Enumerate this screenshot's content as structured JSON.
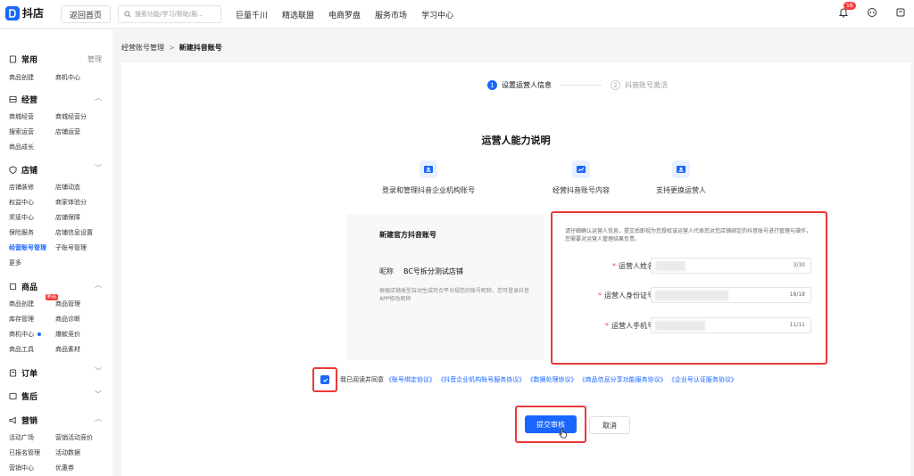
{
  "topbar": {
    "logo_text": "抖店",
    "back_home": "返回首页",
    "search_placeholder": "搜索功能/学习/帮助/服...",
    "nav": [
      "巨量千川",
      "精选联盟",
      "电商罗盘",
      "服务市场",
      "学习中心"
    ],
    "notif_count": "16"
  },
  "sidebar": {
    "common": {
      "title": "常用",
      "manage": "管理",
      "items": [
        "商品创建",
        "商机中心"
      ]
    },
    "operations": {
      "title": "经营",
      "items": [
        "商城经营",
        "商城经营分",
        "搜索运营",
        "店铺运营",
        "商品成长"
      ]
    },
    "store": {
      "title": "店铺",
      "items": [
        "店铺装修",
        "店铺动态",
        "权益中心",
        "商家体验分",
        "奖惩中心",
        "店铺保障",
        "保险服务",
        "店铺信息设置",
        "经营账号管理",
        "子账号管理",
        "更多"
      ]
    },
    "goods": {
      "title": "商品",
      "new_tag": "新品",
      "items": [
        "商品创建",
        "商品管理",
        "库存管理",
        "商品诊断",
        "商机中心",
        "爆款竞价",
        "商品工具",
        "商品素材"
      ]
    },
    "orders": {
      "title": "订单"
    },
    "aftersale": {
      "title": "售后"
    },
    "marketing": {
      "title": "营销",
      "items": [
        "活动广场",
        "营销活动竞价",
        "已报名管理",
        "活动数据",
        "营销中心",
        "优惠券"
      ]
    }
  },
  "breadcrumb": {
    "parent": "经营账号管理",
    "sep": ">",
    "current": "新建抖音账号"
  },
  "steps": [
    {
      "num": "1",
      "label": "设置运营人信息"
    },
    {
      "num": "2",
      "label": "抖音账号激活"
    }
  ],
  "capabilities": {
    "title": "运营人能力说明",
    "items": [
      "登录和管理抖音企业机构账号",
      "经营抖音账号内容",
      "支持更换运营人"
    ]
  },
  "official_account": {
    "title": "新建官方抖音账号",
    "nickname_label": "昵称",
    "nickname_value": "BC号拆分测试店铺",
    "desc": "根据店铺类型自动生成符合平台规范的账号昵称，您可登录抖音APP修改昵称"
  },
  "form": {
    "notice": "请仔细确认运营人信息，提交后即视为您授权该运营人代表您对您店铺绑定的抖音账号进行管理与操作，您需要对运营人管理结果负责。",
    "required_mark": "*",
    "fields": [
      {
        "label": "运营人姓名",
        "count": "3/30"
      },
      {
        "label": "运营人身份证号",
        "count": "18/18"
      },
      {
        "label": "运营人手机号",
        "count": "11/11"
      }
    ]
  },
  "agreement": {
    "prefix": "我已阅读并同意",
    "links": "《账号绑定协议》 《抖音企业机构账号服务协议》 《数据处理协议》 《商品信息分享功能服务协议》 《企业号认证服务协议》"
  },
  "actions": {
    "submit": "提交审核",
    "cancel": "取消"
  },
  "colors": {
    "primary": "#1966ff",
    "highlight": "#e83a3a"
  }
}
